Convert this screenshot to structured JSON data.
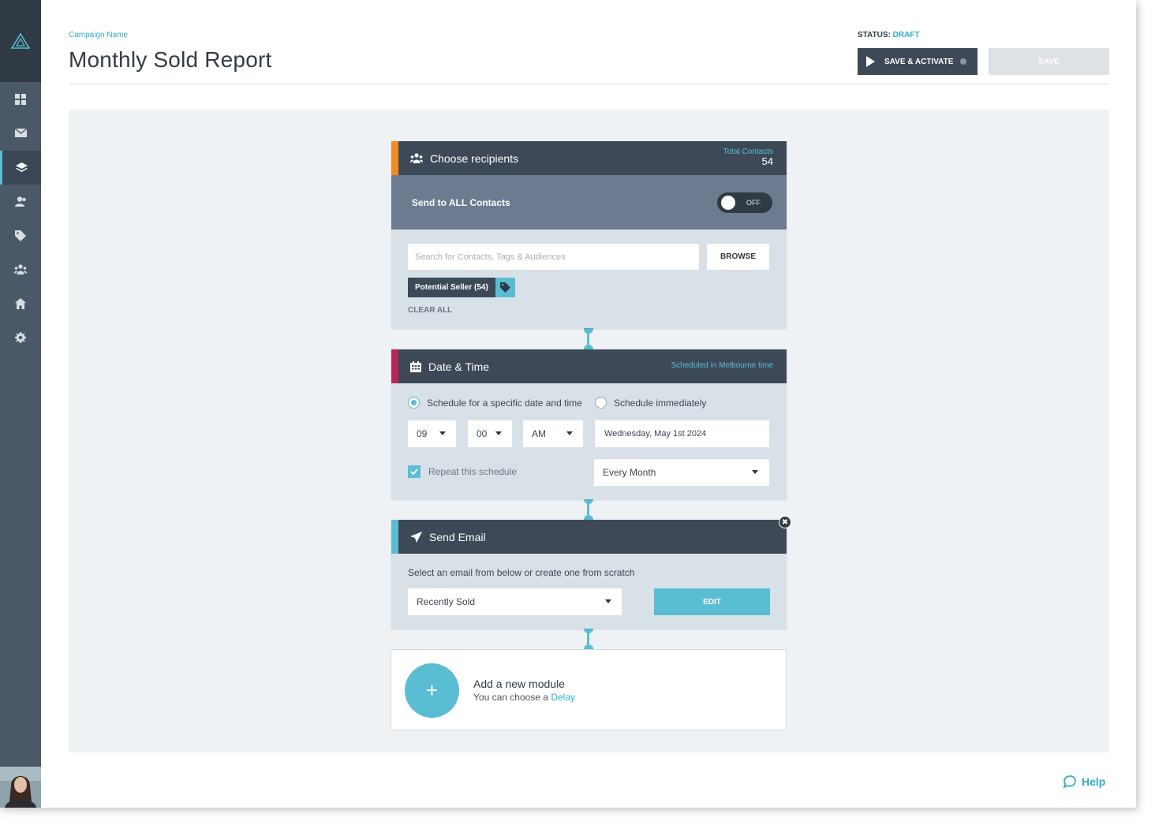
{
  "header": {
    "campaign_label": "Campaign Name",
    "title": "Monthly Sold Report",
    "status_label": "STATUS:",
    "status_value": "DRAFT",
    "save_activate_label": "SAVE & ACTIVATE",
    "save_label": "SAVE"
  },
  "sidebar": {
    "items": [
      {
        "icon": "dashboard-icon"
      },
      {
        "icon": "mail-icon"
      },
      {
        "icon": "layers-icon",
        "active": true
      },
      {
        "icon": "contacts-icon"
      },
      {
        "icon": "tag-icon"
      },
      {
        "icon": "audience-icon"
      },
      {
        "icon": "home-icon"
      },
      {
        "icon": "gear-icon"
      }
    ]
  },
  "recipients": {
    "title": "Choose recipients",
    "total_label": "Total Contacts",
    "total_value": "54",
    "send_all_label": "Send to ALL Contacts",
    "toggle_label": "OFF",
    "search_placeholder": "Search for Contacts, Tags & Audiences",
    "browse_label": "BROWSE",
    "tag_label": "Potential Seller (54)",
    "clear_all_label": "CLEAR ALL",
    "accent": "#f48a1f"
  },
  "datetime": {
    "title": "Date & Time",
    "timezone_note": "Scheduled in Melbourne time",
    "radio_specific": "Schedule for a specific date and time",
    "radio_immediate": "Schedule immediately",
    "hour": "09",
    "minute": "00",
    "ampm": "AM",
    "date": "Wednesday, May 1st 2024",
    "repeat_label": "Repeat this schedule",
    "repeat_value": "Every Month",
    "accent": "#b8245d"
  },
  "send_email": {
    "title": "Send Email",
    "instruction": "Select an email from below or create one from scratch",
    "email_value": "Recently Sold",
    "edit_label": "EDIT",
    "close_glyph": "✖",
    "accent": "#5bbdd3"
  },
  "add_module": {
    "plus_glyph": "+",
    "title": "Add a new module",
    "sub_prefix": "You can choose a",
    "sub_link": "Delay"
  },
  "help": {
    "label": "Help"
  },
  "colors": {
    "sidebar": "#4b5867",
    "header_dark": "#3d4957",
    "teal": "#5bbdd3"
  }
}
